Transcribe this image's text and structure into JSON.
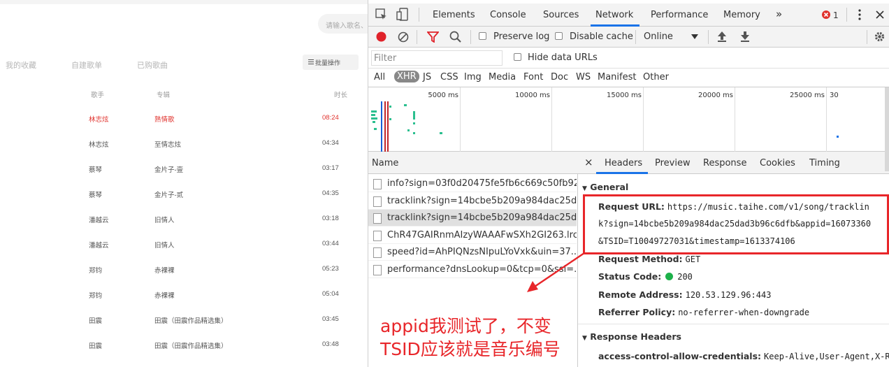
{
  "left_page": {
    "search_placeholder": "请输入歌名、",
    "tabs": [
      "我的收藏",
      "自建歌单",
      "已购歌曲"
    ],
    "batch_button": "批量操作",
    "columns": {
      "artist": "歌手",
      "album": "专辑",
      "duration": "时长"
    },
    "songs": [
      {
        "artist": "林志炫",
        "album": "熟情歌",
        "duration": "08:24",
        "active": true
      },
      {
        "artist": "林志炫",
        "album": "至情志炫",
        "duration": "04:34"
      },
      {
        "artist": "蔡琴",
        "album": "金片子-壹",
        "duration": "03:17"
      },
      {
        "artist": "蔡琴",
        "album": "金片子-贰",
        "duration": "04:35"
      },
      {
        "artist": "潘越云",
        "album": "旧情人",
        "duration": "03:18"
      },
      {
        "artist": "潘越云",
        "album": "旧情人",
        "duration": "03:44"
      },
      {
        "artist": "郑钧",
        "album": "赤裸裸",
        "duration": "05:23"
      },
      {
        "artist": "郑钧",
        "album": "赤裸裸",
        "duration": "05:04"
      },
      {
        "artist": "田震",
        "album": "田震（田震作品精选集）",
        "duration": "03:45"
      },
      {
        "artist": "田震",
        "album": "田震（田震作品精选集）",
        "duration": "03:48"
      }
    ]
  },
  "devtools": {
    "panel_tabs": [
      "Elements",
      "Console",
      "Sources",
      "Network",
      "Performance",
      "Memory"
    ],
    "selected_panel": "Network",
    "more_tabs": "»",
    "error_count": "1",
    "toolbar": {
      "preserve_log": "Preserve log",
      "disable_cache": "Disable cache",
      "throttling": "Online"
    },
    "filter_placeholder": "Filter",
    "hide_data_urls": "Hide data URLs",
    "type_filters": [
      "All",
      "XHR",
      "JS",
      "CSS",
      "Img",
      "Media",
      "Font",
      "Doc",
      "WS",
      "Manifest",
      "Other"
    ],
    "selected_type": "XHR",
    "timeline_ticks": [
      "5000 ms",
      "10000 ms",
      "15000 ms",
      "20000 ms",
      "25000 ms",
      "30"
    ],
    "name_header": "Name",
    "requests": [
      "info?sign=03f0d20475fe5fb6c669c50fb92...",
      "tracklink?sign=14bcbe5b209a984dac25da...",
      "tracklink?sign=14bcbe5b209a984dac25da...",
      "ChR47GAIRnmAIzyWAAAFwSXh2GI263.lrc",
      "speed?id=AhPIQNzsNIpuLYoVxk&uin=37...",
      "performance?dnsLookup=0&tcp=0&ssl=..."
    ],
    "selected_request": 2,
    "detail_tabs": [
      "Headers",
      "Preview",
      "Response",
      "Cookies",
      "Timing"
    ],
    "selected_detail_tab": "Headers",
    "close_symbol": "×",
    "general_title": "General",
    "request_url_label": "Request URL:",
    "request_url_lines": [
      "https://music.taihe.com/v1/song/tracklin",
      "k?sign=14bcbe5b209a984dac25dad3b96c6dfb&appid=16073360",
      "&TSID=T10049727031&timestamp=1613374106"
    ],
    "request_method_label": "Request Method:",
    "request_method": "GET",
    "status_code_label": "Status Code:",
    "status_code": "200",
    "status_color": "#1db14a",
    "remote_address_label": "Remote Address:",
    "remote_address": "120.53.129.96:443",
    "referrer_policy_label": "Referrer Policy:",
    "referrer_policy": "no-referrer-when-downgrade",
    "response_headers_title": "Response Headers",
    "acao_label": "access-control-allow-credentials:",
    "acao_value": "Keep-Alive,User-Agent,X-R"
  },
  "annotation": {
    "lines": [
      "appid我测试了，不变",
      "TSID应该就是音乐编号"
    ],
    "color": "#e8262a"
  }
}
